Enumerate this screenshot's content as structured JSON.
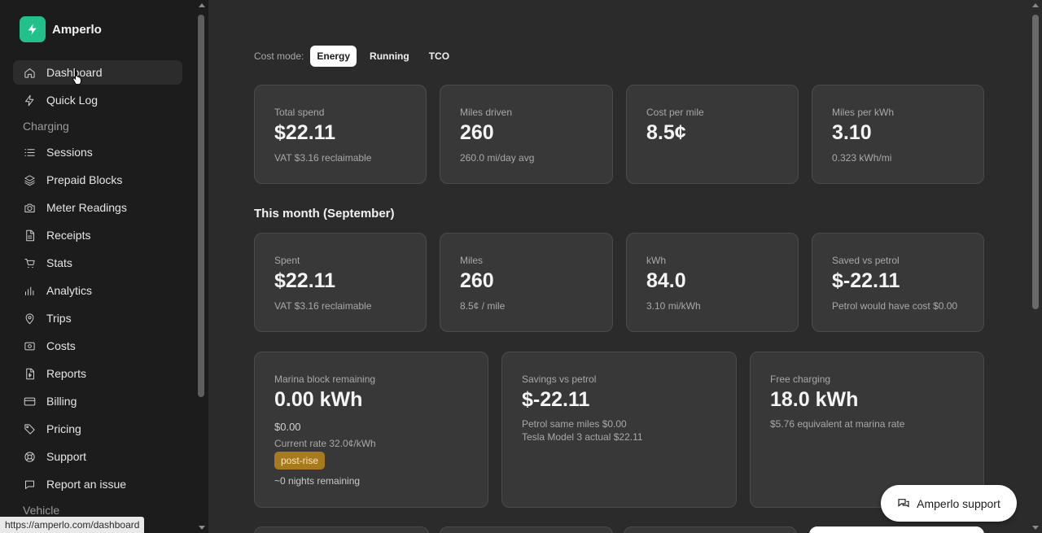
{
  "brand": {
    "name": "Amperlo",
    "accent": "#22c08a"
  },
  "nav": {
    "items": [
      {
        "label": "Dashboard",
        "icon": "home-icon"
      },
      {
        "label": "Quick Log",
        "icon": "bolt-icon"
      }
    ],
    "charging_section": "Charging",
    "charging_items": [
      {
        "label": "Sessions",
        "icon": "list-icon"
      },
      {
        "label": "Prepaid Blocks",
        "icon": "layers-icon"
      },
      {
        "label": "Meter Readings",
        "icon": "camera-icon"
      },
      {
        "label": "Receipts",
        "icon": "receipt-icon"
      },
      {
        "label": "Stats",
        "icon": "cart-icon"
      },
      {
        "label": "Analytics",
        "icon": "bar-chart-icon"
      },
      {
        "label": "Trips",
        "icon": "map-pin-icon"
      },
      {
        "label": "Costs",
        "icon": "wallet-icon"
      },
      {
        "label": "Reports",
        "icon": "file-dollar-icon"
      },
      {
        "label": "Billing",
        "icon": "credit-card-icon"
      },
      {
        "label": "Pricing",
        "icon": "tag-icon"
      },
      {
        "label": "Support",
        "icon": "lifebuoy-icon"
      },
      {
        "label": "Report an issue",
        "icon": "chat-icon"
      }
    ],
    "vehicle_section": "Vehicle"
  },
  "status_url": "https://amperlo.com/dashboard",
  "cost_mode": {
    "label": "Cost mode:",
    "options": [
      "Energy",
      "Running",
      "TCO"
    ],
    "selected": "Energy"
  },
  "summary": [
    {
      "label": "Total spend",
      "value": "$22.11",
      "sub": "VAT $3.16 reclaimable"
    },
    {
      "label": "Miles driven",
      "value": "260",
      "sub": "260.0 mi/day avg"
    },
    {
      "label": "Cost per mile",
      "value": "8.5¢",
      "sub": ""
    },
    {
      "label": "Miles per kWh",
      "value": "3.10",
      "sub": "0.323 kWh/mi"
    }
  ],
  "month_title": "This month (September)",
  "month": [
    {
      "label": "Spent",
      "value": "$22.11",
      "sub": "VAT $3.16 reclaimable"
    },
    {
      "label": "Miles",
      "value": "260",
      "sub": "8.5¢ / mile"
    },
    {
      "label": "kWh",
      "value": "84.0",
      "sub": "3.10 mi/kWh"
    },
    {
      "label": "Saved vs petrol",
      "value": "$-22.11",
      "sub": "Petrol would have cost $0.00"
    }
  ],
  "marina": {
    "label": "Marina block remaining",
    "value": "0.00 kWh",
    "amount": "$0.00",
    "rate": "Current rate 32.0¢/kWh",
    "badge": "post-rise",
    "nights": "~0 nights remaining"
  },
  "savings": {
    "label": "Savings vs petrol",
    "value": "$-22.11",
    "line1": "Petrol same miles $0.00",
    "line2": "Tesla Model 3 actual $22.11"
  },
  "free": {
    "label": "Free charging",
    "value": "18.0 kWh",
    "sub": "$5.76 equivalent at marina rate"
  },
  "support_button": "Amperlo support"
}
